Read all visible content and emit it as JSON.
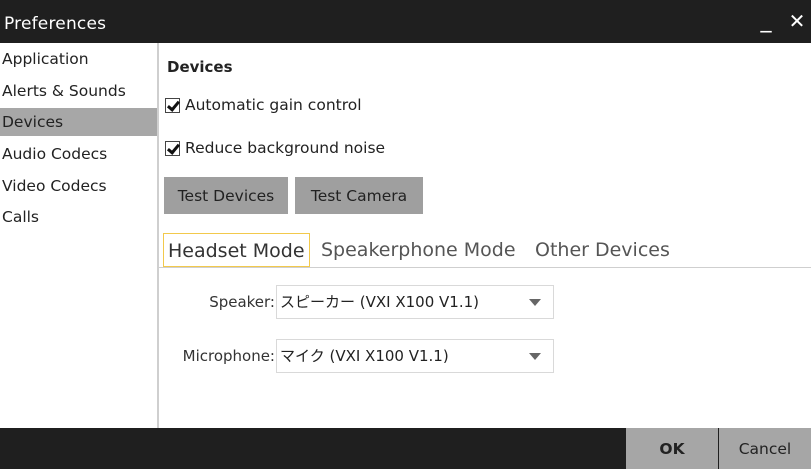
{
  "window": {
    "title": "Preferences",
    "minimize_glyph": "_",
    "close_glyph": "✕"
  },
  "sidebar": {
    "items": [
      {
        "label": "Application",
        "selected": false
      },
      {
        "label": "Alerts & Sounds",
        "selected": false
      },
      {
        "label": "Devices",
        "selected": true
      },
      {
        "label": "Audio Codecs",
        "selected": false
      },
      {
        "label": "Video Codecs",
        "selected": false
      },
      {
        "label": "Calls",
        "selected": false
      }
    ]
  },
  "devices": {
    "section_title": "Devices",
    "agc_label": "Automatic gain control",
    "agc_checked": true,
    "noise_label": "Reduce background noise",
    "noise_checked": true,
    "test_devices_label": "Test Devices",
    "test_camera_label": "Test Camera"
  },
  "tabs": [
    {
      "label": "Headset Mode",
      "active": true
    },
    {
      "label": "Speakerphone Mode",
      "active": false
    },
    {
      "label": "Other Devices",
      "active": false
    }
  ],
  "fields": {
    "speaker_label": "Speaker:",
    "speaker_value": "スピーカー (VXI X100 V1.1)",
    "microphone_label": "Microphone:",
    "microphone_value": "マイク (VXI X100 V1.1)"
  },
  "footer": {
    "ok_label": "OK",
    "cancel_label": "Cancel"
  },
  "colors": {
    "titlebar_bg": "#1f1f1f",
    "selected_bg": "#a7a7a7",
    "button_bg": "#9f9f9f",
    "active_tab_border": "#f2c94c"
  }
}
